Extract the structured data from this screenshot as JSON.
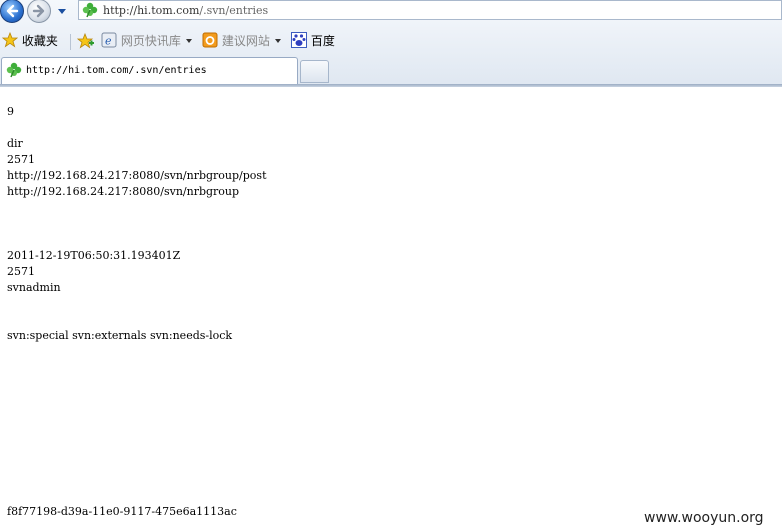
{
  "address_bar": {
    "url_prefix": "http://hi.",
    "url_domain": "tom.com",
    "url_path": "/.svn/entries"
  },
  "favorites_bar": {
    "favorites_label": "收藏夹",
    "quick_library_label": "网页快讯库",
    "suggested_sites_label": "建议网站",
    "baidu_label": "百度"
  },
  "tab": {
    "title": "http://hi.tom.com/.svn/entries"
  },
  "document": {
    "lines": [
      "9",
      "",
      "dir",
      "2571",
      "http://192.168.24.217:8080/svn/nrbgroup/post",
      "http://192.168.24.217:8080/svn/nrbgroup",
      "",
      "",
      "",
      "2011-12-19T06:50:31.193401Z",
      "2571",
      "svnadmin",
      "",
      "",
      "svn:special svn:externals svn:needs-lock",
      "",
      "",
      "",
      "",
      "",
      "",
      "",
      "",
      "",
      "",
      "f8f77198-d39a-11e0-9117-475e6a1113ac"
    ]
  },
  "watermark": "www.wooyun.org"
}
